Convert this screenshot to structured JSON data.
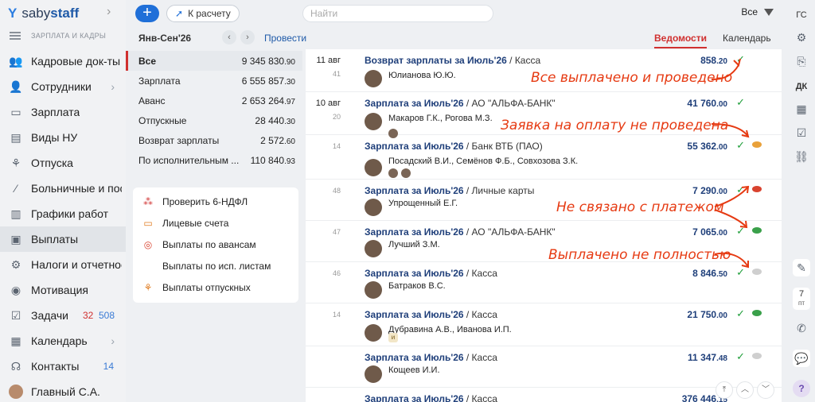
{
  "brand": {
    "name_part1": "saby",
    "name_part2": "staff"
  },
  "sidebar": {
    "section": "ЗАРПЛАТА И КАДРЫ",
    "items": [
      {
        "label": "Кадровые док-ты",
        "icon": "people-icon"
      },
      {
        "label": "Сотрудники",
        "icon": "user-icon",
        "chevron": true
      },
      {
        "label": "Зарплата",
        "icon": "wallet-icon"
      },
      {
        "label": "Виды НУ",
        "icon": "box-icon"
      },
      {
        "label": "Отпуска",
        "icon": "palm-icon"
      },
      {
        "label": "Больничные и пос",
        "icon": "thermometer-icon"
      },
      {
        "label": "Графики работ",
        "icon": "chart-icon"
      },
      {
        "label": "Выплаты",
        "icon": "cash-icon",
        "active": true
      },
      {
        "label": "Налоги и отчетнос",
        "icon": "tax-icon"
      },
      {
        "label": "Мотивация",
        "icon": "medal-icon"
      },
      {
        "label": "Задачи",
        "icon": "tasks-icon",
        "count_red": "32",
        "count_blue": "508"
      },
      {
        "label": "Календарь",
        "icon": "calendar-icon",
        "chevron": true
      },
      {
        "label": "Контакты",
        "icon": "chat-icon",
        "count": "14"
      },
      {
        "label": "Главный С.А.",
        "icon": "avatar"
      }
    ]
  },
  "topbar": {
    "calc_label": "К расчету",
    "search_placeholder": "Найти",
    "filter_label": "Все"
  },
  "period": {
    "label": "Янв-Сен'26",
    "conduct_label": "Провести"
  },
  "tabs": [
    {
      "label": "Ведомости",
      "active": true
    },
    {
      "label": "Календарь",
      "active": false
    }
  ],
  "summary": [
    {
      "name": "Все",
      "int": "9 345 830",
      "dec": ".90",
      "active": true
    },
    {
      "name": "Зарплата",
      "int": "6 555 857",
      "dec": ".30"
    },
    {
      "name": "Аванс",
      "int": "2 653 264",
      "dec": ".97"
    },
    {
      "name": "Отпускные",
      "int": "28 440",
      "dec": ".30"
    },
    {
      "name": "Возврат зарплаты",
      "int": "2 572",
      "dec": ".60"
    },
    {
      "name": "По исполнительным ...",
      "int": "110 840",
      "dec": ".93"
    }
  ],
  "links": [
    {
      "label": "Проверить 6-НДФЛ",
      "icon": "check-list-icon"
    },
    {
      "label": "Лицевые счета",
      "icon": "card-icon"
    },
    {
      "label": "Выплаты по авансам",
      "icon": "coins-icon"
    },
    {
      "label": "Выплаты по исп. листам",
      "icon": ""
    },
    {
      "label": "Выплаты отпускных",
      "icon": "palm-icon"
    }
  ],
  "entries": [
    {
      "date": "11 авг",
      "num": "41",
      "title": "Возврат зарплаты за Июль'26",
      "source": " / Касса",
      "amount_int": "858",
      "amount_dec": ".20",
      "persons": "Юлианова Ю.Ю.",
      "coin": ""
    },
    {
      "date": "10 авг",
      "num": "20",
      "title": "Зарплата за Июль'26",
      "source": " / АО \"АЛЬФА-БАНК\"",
      "amount_int": "41 760",
      "amount_dec": ".00",
      "persons": "Макаров Г.К., Рогова М.З.",
      "coin": "",
      "mini": 1
    },
    {
      "date": "",
      "num": "14",
      "title": "Зарплата за Июль'26",
      "source": " / Банк ВТБ (ПАО)",
      "amount_int": "55 362",
      "amount_dec": ".00",
      "persons": "Посадский В.И., Семёнов Ф.Б., Совхозова З.К.",
      "coin": "#e9a13a",
      "mini": 2
    },
    {
      "date": "",
      "num": "48",
      "title": "Зарплата за Июль'26",
      "source": " / Личные карты",
      "amount_int": "7 290",
      "amount_dec": ".00",
      "persons": "Упрощенный Е.Г.",
      "coin": "#d9432f"
    },
    {
      "date": "",
      "num": "47",
      "title": "Зарплата за Июль'26",
      "source": " / АО \"АЛЬФА-БАНК\"",
      "amount_int": "7 065",
      "amount_dec": ".00",
      "persons": "Лучший З.М.",
      "coin": "#3aa04a"
    },
    {
      "date": "",
      "num": "46",
      "title": "Зарплата за Июль'26",
      "source": " / Касса",
      "amount_int": "8 846",
      "amount_dec": ".50",
      "persons": "Батраков В.С.",
      "coin": "#cfcfcf"
    },
    {
      "date": "",
      "num": "14",
      "title": "Зарплата за Июль'26",
      "source": " / Касса",
      "amount_int": "21 750",
      "amount_dec": ".00",
      "persons": "Дубравина А.В., Иванова И.П.",
      "coin": "#3aa04a",
      "tag": "и"
    },
    {
      "date": "",
      "num": "",
      "title": "Зарплата за Июль'26",
      "source": " / Касса",
      "amount_int": "11 347",
      "amount_dec": ".48",
      "persons": "Кощеев И.И.",
      "coin": "#cfcfcf"
    },
    {
      "date": "",
      "num": "",
      "title": "Зарплата за Июль'26",
      "source": " / Касса",
      "amount_int": "376 446",
      "amount_dec": ".15",
      "persons": "",
      "coin": ""
    }
  ],
  "callouts": [
    "Все выплачено и проведено",
    "Заявка на оплату не проведена",
    "Не связано с платежом",
    "Выплачено не полностью"
  ],
  "rail": {
    "top_label": "ГС",
    "dk_label": "ДК",
    "day_num": "7",
    "day_name": "пт",
    "help": "?"
  },
  "colors": {
    "accent": "#d0302f",
    "primary": "#1f6fd8",
    "callout": "#e63a12",
    "success": "#1f9e3a"
  }
}
